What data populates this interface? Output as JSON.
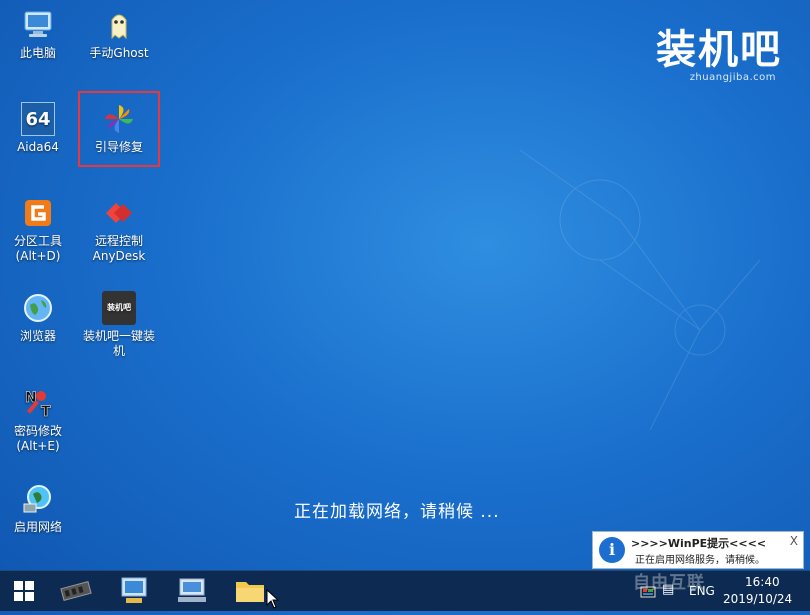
{
  "brand": {
    "title": "装机吧",
    "subtitle": "zhuangjiba.com"
  },
  "desktop_icons": [
    {
      "label": "此电脑"
    },
    {
      "label": "手动Ghost"
    },
    {
      "label": "Aida64"
    },
    {
      "label": "引导修复"
    },
    {
      "label": "分区工具\n(Alt+D)"
    },
    {
      "label": "远程控制\nAnyDesk"
    },
    {
      "label": "浏览器"
    },
    {
      "label": "装机吧一键装\n机"
    },
    {
      "label": "密码修改\n(Alt+E)"
    },
    {
      "label": "启用网络"
    }
  ],
  "aida_icon_text": "64",
  "zjb_icon_text": "装机吧",
  "status_message": "正在加载网络，请稍候 ...",
  "notification": {
    "title": ">>>>WinPE提示<<<<",
    "body": "正在启用网络服务，请稍候。",
    "close": "X",
    "info_symbol": "i"
  },
  "taskbar": {
    "language": "ENG",
    "time": "16:40",
    "date": "2019/10/24"
  },
  "watermark": "自由互联",
  "colors": {
    "desktop": "#1a6fcc",
    "taskbar": "#0c2a52",
    "selection": "#e8383d"
  }
}
